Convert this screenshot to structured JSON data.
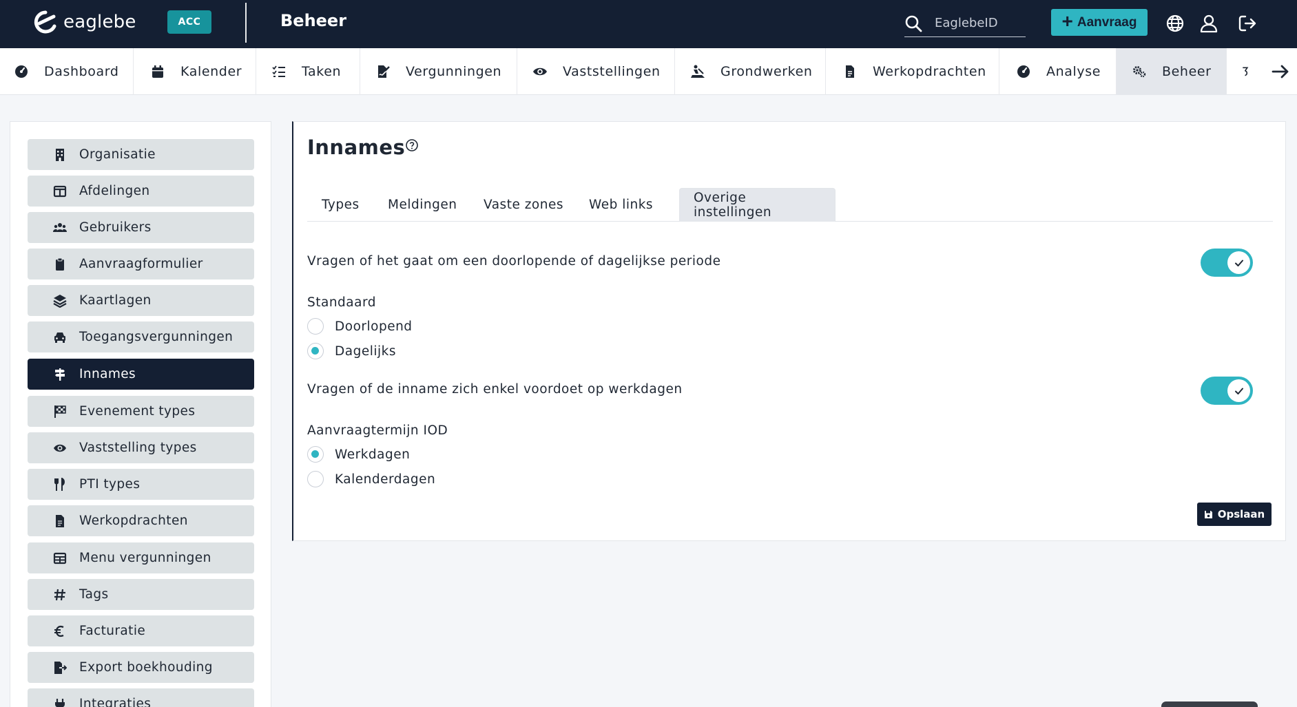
{
  "topbar": {
    "logo_text": "eaglebe",
    "env_badge": "ACC",
    "title": "Beheer",
    "search_placeholder": "EaglebeID",
    "new_request_label": "Aanvraag",
    "colors": {
      "background": "#141f33",
      "accent": "#2fb5c2",
      "badge": "#17939c"
    },
    "icons": [
      "search-icon",
      "globe-icon",
      "user-icon",
      "logout-icon"
    ]
  },
  "nav": {
    "items": [
      {
        "label": "Dashboard",
        "icon": "gauge-icon"
      },
      {
        "label": "Kalender",
        "icon": "calendar-icon"
      },
      {
        "label": "Taken",
        "icon": "tasks-icon"
      },
      {
        "label": "Vergunningen",
        "icon": "file-signature-icon"
      },
      {
        "label": "Vaststellingen",
        "icon": "eye-icon"
      },
      {
        "label": "Grondwerken",
        "icon": "digging-icon"
      },
      {
        "label": "Werkopdrachten",
        "icon": "file-icon"
      },
      {
        "label": "Analyse",
        "icon": "gauge-icon"
      },
      {
        "label": "Beheer",
        "icon": "cogs-icon",
        "active": true
      }
    ],
    "more_icon": "arrow-right-icon"
  },
  "sidebar": {
    "items": [
      {
        "label": "Organisatie",
        "icon": "building-icon"
      },
      {
        "label": "Afdelingen",
        "icon": "columns-icon"
      },
      {
        "label": "Gebruikers",
        "icon": "users-icon"
      },
      {
        "label": "Aanvraagformulier",
        "icon": "clipboard-icon"
      },
      {
        "label": "Kaartlagen",
        "icon": "layers-icon"
      },
      {
        "label": "Toegangsvergunningen",
        "icon": "car-icon"
      },
      {
        "label": "Innames",
        "icon": "signs-icon",
        "active": true
      },
      {
        "label": "Evenement types",
        "icon": "flag-checkered-icon"
      },
      {
        "label": "Vaststelling types",
        "icon": "eye-icon"
      },
      {
        "label": "PTI types",
        "icon": "utensils-icon"
      },
      {
        "label": "Werkopdrachten",
        "icon": "file-icon"
      },
      {
        "label": "Menu vergunningen",
        "icon": "table-icon"
      },
      {
        "label": "Tags",
        "icon": "hashtag-icon"
      },
      {
        "label": "Facturatie",
        "icon": "euro-icon"
      },
      {
        "label": "Export boekhouding",
        "icon": "file-export-icon"
      },
      {
        "label": "Integraties",
        "icon": "plug-icon"
      }
    ]
  },
  "main": {
    "title": "Innames",
    "tabs": [
      {
        "label": "Types"
      },
      {
        "label": "Meldingen"
      },
      {
        "label": "Vaste zones"
      },
      {
        "label": "Web links"
      },
      {
        "label": "Overige instellingen",
        "active": true
      }
    ],
    "settings": {
      "periode_question": "Vragen of het gaat om een doorlopende of dagelijkse periode",
      "periode_toggle_on": true,
      "standaard_label": "Standaard",
      "standaard_options": [
        {
          "label": "Doorlopend",
          "checked": false
        },
        {
          "label": "Dagelijks",
          "checked": true
        }
      ],
      "werkdagen_question": "Vragen of de inname zich enkel voordoet op werkdagen",
      "werkdagen_toggle_on": true,
      "termijn_label": "Aanvraagtermijn IOD",
      "termijn_options": [
        {
          "label": "Werkdagen",
          "checked": true
        },
        {
          "label": "Kalenderdagen",
          "checked": false
        }
      ]
    },
    "save_label": "Opslaan"
  }
}
